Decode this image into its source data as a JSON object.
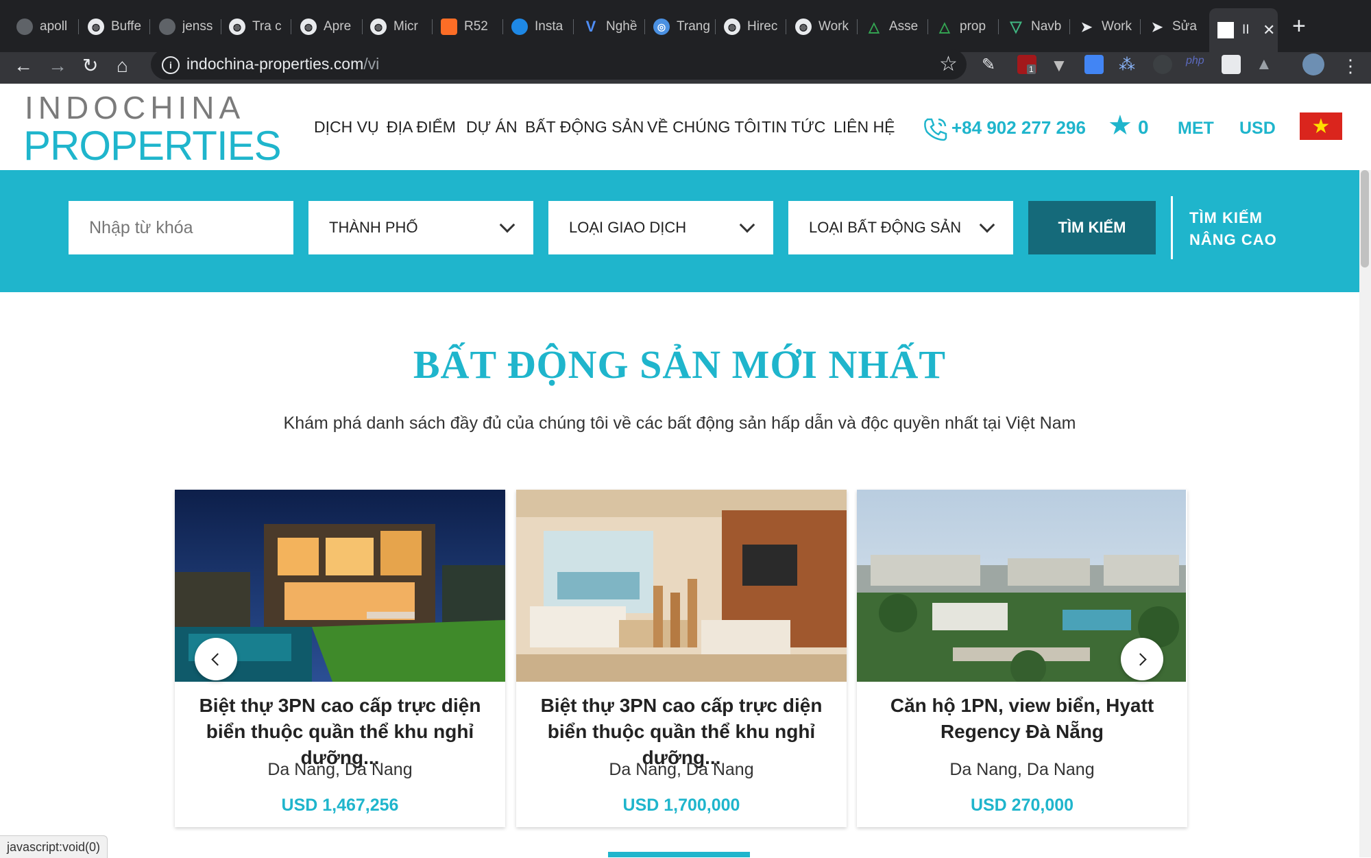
{
  "browser": {
    "tabs": [
      {
        "label": "apoll",
        "icon": "github-icon"
      },
      {
        "label": "Buffe",
        "icon": "globe-icon"
      },
      {
        "label": "jenss",
        "icon": "github-icon"
      },
      {
        "label": "Tra c",
        "icon": "globe-icon"
      },
      {
        "label": "Apre",
        "icon": "globe-icon"
      },
      {
        "label": "Micr",
        "icon": "globe-icon"
      },
      {
        "label": "R52",
        "icon": "gitlab-icon"
      },
      {
        "label": "Insta",
        "icon": "insta-icon"
      },
      {
        "label": "Nghề",
        "icon": "v-icon"
      },
      {
        "label": "Trang",
        "icon": "compass-icon"
      },
      {
        "label": "Hirec",
        "icon": "globe-icon"
      },
      {
        "label": "Work",
        "icon": "globe-icon"
      },
      {
        "label": "Asse",
        "icon": "drive-icon"
      },
      {
        "label": "prop",
        "icon": "drive-icon"
      },
      {
        "label": "Navb",
        "icon": "vue-icon"
      },
      {
        "label": "Work",
        "icon": "arrow-icon"
      },
      {
        "label": "Sửa",
        "icon": "arrow-icon"
      }
    ],
    "active_tab": "II",
    "url_host": "indochina-properties.com",
    "url_path": "/vi",
    "extension_badge": "1"
  },
  "header": {
    "logo_top": "INDOCHINA",
    "logo_bottom": "PROPERTIES",
    "nav": [
      "DỊCH VỤ",
      "ĐỊA ĐIỂM",
      "DỰ ÁN",
      "BẤT ĐỘNG SẢN",
      "VỀ CHÚNG TÔI",
      "TIN TỨC",
      "LIÊN HỆ"
    ],
    "phone": "+84 902 277 296",
    "favorites_count": "0",
    "unit": "MET",
    "currency": "USD",
    "flag": "vietnam-flag"
  },
  "search": {
    "keyword_placeholder": "Nhập từ khóa",
    "city": "THÀNH PHỐ",
    "transaction_type": "LOẠI GIAO DỊCH",
    "property_type": "LOẠI BẤT ĐỘNG SẢN",
    "search_button": "TÌM KIẾM",
    "advanced_line1": "TÌM KIẾM",
    "advanced_line2": "NÂNG CAO"
  },
  "section": {
    "title": "BẤT ĐỘNG SẢN MỚI NHẤT",
    "subtitle": "Khám phá danh sách đầy đủ của chúng tôi về các bất động sản hấp dẫn và độc quyền nhất tại Việt Nam"
  },
  "listings": [
    {
      "title": "Biệt thự 3PN cao cấp trực diện biển thuộc quần thể khu nghỉ dưỡng...",
      "location": "Da Nang, Da Nang",
      "price": "USD 1,467,256"
    },
    {
      "title": "Biệt thự 3PN cao cấp trực diện biển thuộc quần thể khu nghỉ dưỡng...",
      "location": "Da Nang, Da Nang",
      "price": "USD 1,700,000"
    },
    {
      "title": "Căn hộ 1PN, view biển, Hyatt Regency Đà Nẵng",
      "location": "Da Nang, Da Nang",
      "price": "USD 270,000"
    }
  ],
  "status_bar": "javascript:void(0)",
  "colors": {
    "accent": "#1fb5cc",
    "button_dark": "#156a7a",
    "chrome_dark": "#202124"
  }
}
